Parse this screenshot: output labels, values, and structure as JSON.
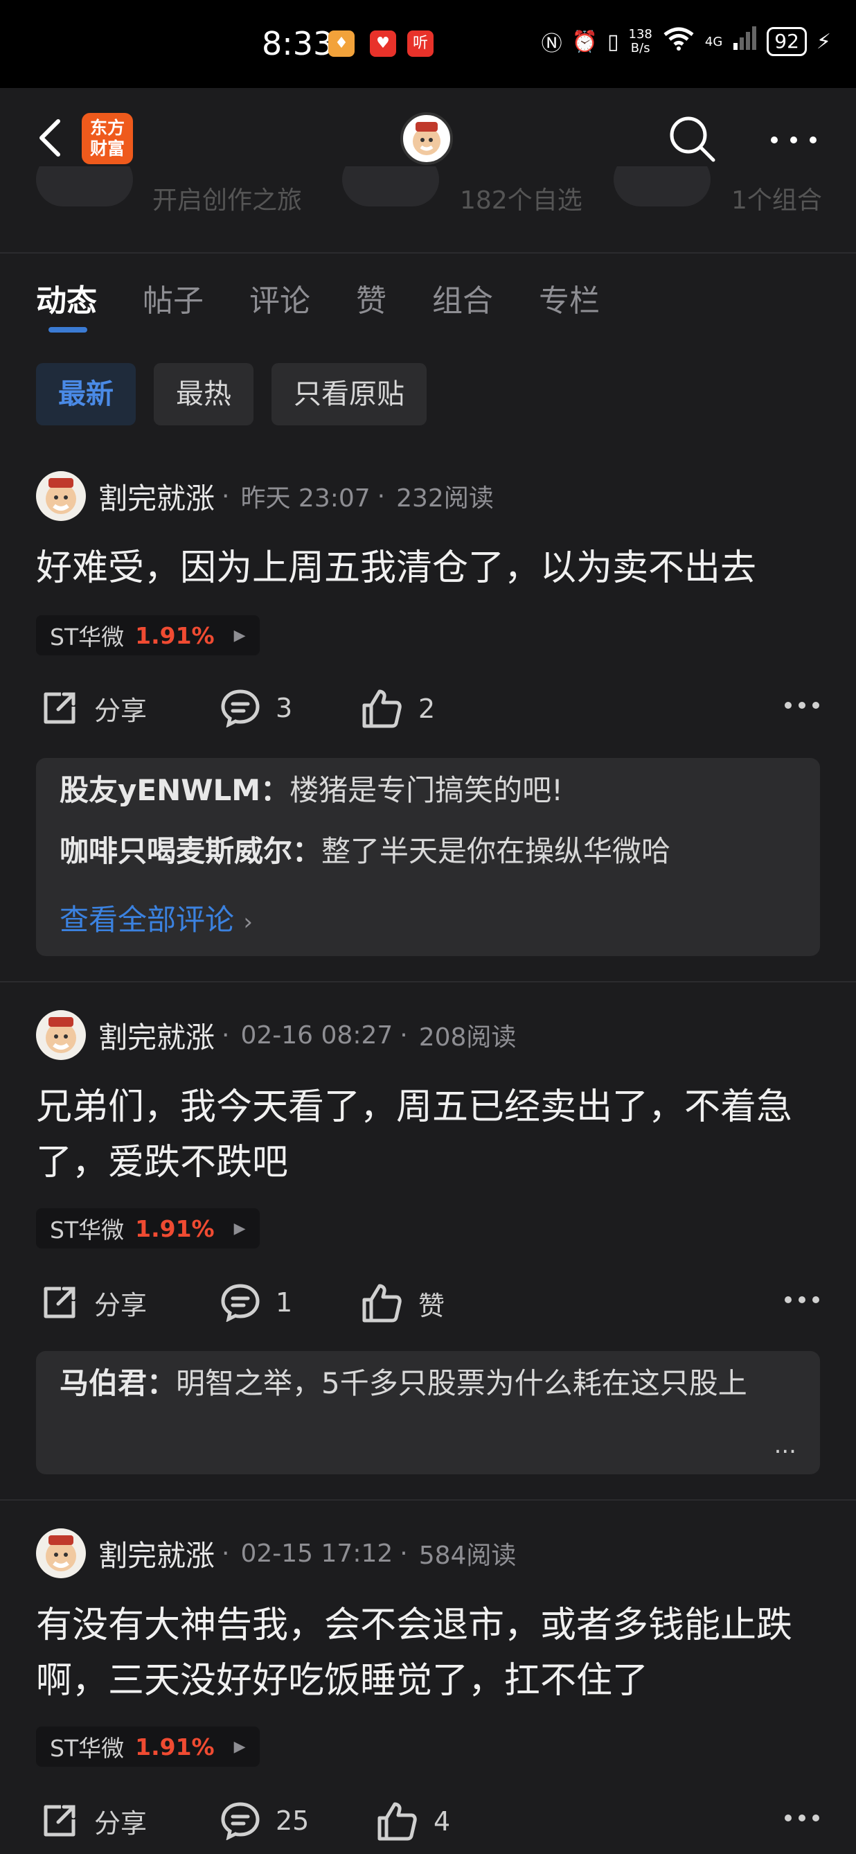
{
  "status_bar": {
    "time": "8:33",
    "speed_value": "138",
    "speed_unit": "B/s",
    "network": "4G",
    "battery": "92"
  },
  "nav": {
    "app_logo_line1": "东方",
    "app_logo_line2": "财富"
  },
  "stats": {
    "item1": "开启创作之旅",
    "item2": "182个自选",
    "item3": "1个组合"
  },
  "tabs": [
    "动态",
    "帖子",
    "评论",
    "赞",
    "组合",
    "专栏"
  ],
  "filters": [
    "最新",
    "最热",
    "只看原贴"
  ],
  "posts": [
    {
      "author": "割完就涨",
      "time": "昨天 23:07",
      "reads": "232阅读",
      "text": "好难受，因为上周五我清仓了，以为卖不出去",
      "stock_name": "ST华微",
      "stock_pct": "1.91%",
      "share_label": "分享",
      "comment_count": "3",
      "like_label": "2",
      "comments": [
        {
          "user": "股友yENWLM：",
          "text": "楼猪是专门搞笑的吧!"
        },
        {
          "user": "咖啡只喝麦斯威尔：",
          "text": "整了半天是你在操纵华微哈"
        }
      ],
      "view_all": "查看全部评论"
    },
    {
      "author": "割完就涨",
      "time": "02-16 08:27",
      "reads": "208阅读",
      "text": "兄弟们，我今天看了，周五已经卖出了，不着急了，爱跌不跌吧",
      "stock_name": "ST华微",
      "stock_pct": "1.91%",
      "share_label": "分享",
      "comment_count": "1",
      "like_label": "赞",
      "comments": [
        {
          "user": "马伯君：",
          "text": "明智之举，5千多只股票为什么耗在这只股上"
        }
      ],
      "ellipsis": "..."
    },
    {
      "author": "割完就涨",
      "time": "02-15 17:12",
      "reads": "584阅读",
      "text": "有没有大神告我，会不会退市，或者多钱能止跌啊，三天没好好吃饭睡觉了，扛不住了",
      "stock_name": "ST华微",
      "stock_pct": "1.91%",
      "share_label": "分享",
      "comment_count": "25",
      "like_label": "4"
    }
  ],
  "colors": {
    "background": "#1c1c1e",
    "accent_blue": "#3b82e0",
    "stock_red": "#f04b32",
    "logo_orange": "#ef5a1c"
  }
}
